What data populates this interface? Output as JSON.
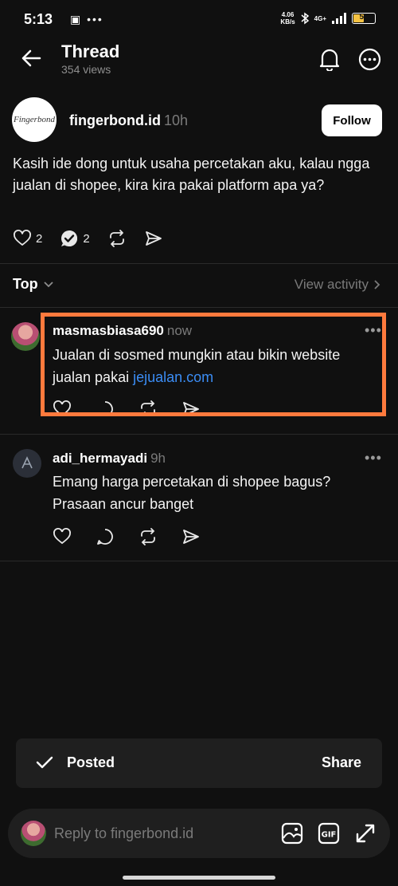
{
  "status_bar": {
    "time": "5:13",
    "left_icons": "▣ •••",
    "net_speed_top": "4.06",
    "net_speed_bottom": "KB/s",
    "network": "4G+",
    "battery": "54",
    "battery_level": 0.54
  },
  "header": {
    "title": "Thread",
    "views": "354 views"
  },
  "post": {
    "avatar_text": "Fingerbond",
    "author": "fingerbond.id",
    "time": "10h",
    "follow_label": "Follow",
    "text": "Kasih ide dong untuk usaha percetakan aku, kalau ngga jualan di shopee, kira kira pakai platform apa ya?",
    "like_count": "2",
    "reply_count": "2"
  },
  "sort": {
    "label": "Top",
    "view_activity": "View activity"
  },
  "replies": [
    {
      "author": "masmasbiasa690",
      "time": "now",
      "text": "Jualan di sosmed mungkin atau bikin website jualan pakai ",
      "link": "jejualan.com",
      "more": "•••"
    },
    {
      "author": "adi_hermayadi",
      "time": "9h",
      "text": "Emang harga percetakan di shopee bagus? Prasaan ancur banget",
      "more": "•••"
    }
  ],
  "toast": {
    "label": "Posted",
    "action": "Share"
  },
  "reply_bar": {
    "placeholder": "Reply to fingerbond.id"
  },
  "colors": {
    "background": "#101010",
    "highlight": "#ff7a3d",
    "link": "#3b8df5"
  }
}
